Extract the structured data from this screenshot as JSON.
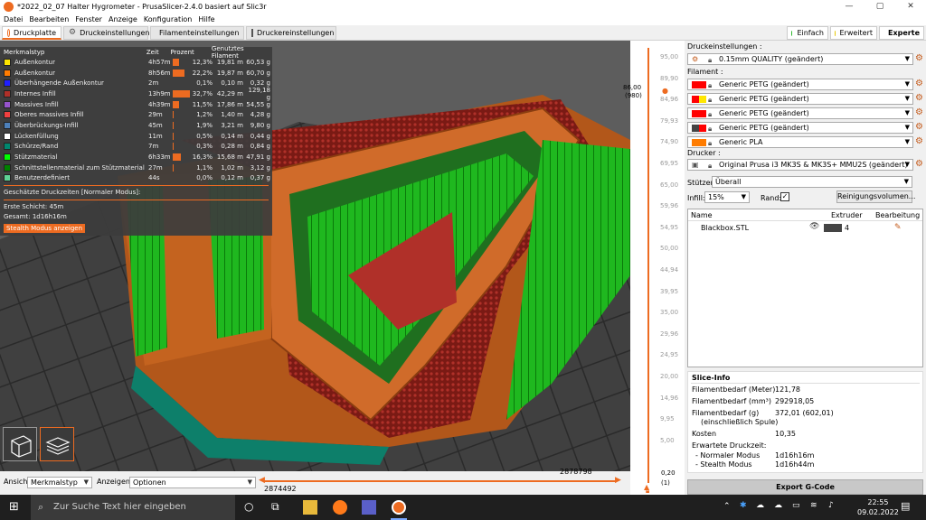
{
  "window": {
    "title": "*2022_02_07 Halter Hygrometer - PrusaSlicer-2.4.0 basiert auf Slic3r",
    "controls": [
      "—",
      "▢",
      "✕"
    ]
  },
  "menu": [
    "Datei",
    "Bearbeiten",
    "Fenster",
    "Anzeige",
    "Konfiguration",
    "Hilfe"
  ],
  "tabs": [
    "Druckplatte",
    "Druckeinstellungen",
    "Filamenteinstellungen",
    "Druckereinstellungen"
  ],
  "modes": {
    "einfach": "Einfach",
    "erweitert": "Erweitert",
    "experte": "Experte",
    "colors": {
      "einfach": "#2eb82e",
      "erweitert": "#e5c700",
      "experte": "#d00000"
    }
  },
  "legend": {
    "headers": {
      "type": "Merkmalstyp",
      "time": "Zeit",
      "percent": "Prozent",
      "filament": "Genutztes Filament"
    },
    "rows": [
      {
        "name": "Außenkontur",
        "time": "4h57m",
        "pct": "12,3%",
        "len": "19,81 m",
        "g": "60,53 g",
        "color": "#ffe600",
        "pct_value": 12.3
      },
      {
        "name": "Außenkontur",
        "time": "8h56m",
        "pct": "22,2%",
        "len": "19,87 m",
        "g": "60,70 g",
        "color": "#ff7c00",
        "pct_value": 22.2
      },
      {
        "name": "Überhängende Außenkontur",
        "time": "2m",
        "pct": "0,1%",
        "len": "0,10 m",
        "g": "0,32 g",
        "color": "#1f1fff",
        "pct_value": 0.1
      },
      {
        "name": "Internes Infill",
        "time": "13h9m",
        "pct": "32,7%",
        "len": "42,29 m",
        "g": "129,18 g",
        "color": "#b03029",
        "pct_value": 32.7
      },
      {
        "name": "Massives Infill",
        "time": "4h39m",
        "pct": "11,5%",
        "len": "17,86 m",
        "g": "54,55 g",
        "color": "#9654cc",
        "pct_value": 11.5
      },
      {
        "name": "Oberes massives Infill",
        "time": "29m",
        "pct": "1,2%",
        "len": "1,40 m",
        "g": "4,28 g",
        "color": "#f04040",
        "pct_value": 1.2
      },
      {
        "name": "Überbrückungs-Infill",
        "time": "45m",
        "pct": "1,9%",
        "len": "3,21 m",
        "g": "9,80 g",
        "color": "#4d80ba",
        "pct_value": 1.9
      },
      {
        "name": "Lückenfüllung",
        "time": "11m",
        "pct": "0,5%",
        "len": "0,14 m",
        "g": "0,44 g",
        "color": "#ffffff",
        "pct_value": 0.5
      },
      {
        "name": "Schürze/Rand",
        "time": "7m",
        "pct": "0,3%",
        "len": "0,28 m",
        "g": "0,84 g",
        "color": "#00876e",
        "pct_value": 0.3
      },
      {
        "name": "Stützmaterial",
        "time": "6h33m",
        "pct": "16,3%",
        "len": "15,68 m",
        "g": "47,91 g",
        "color": "#00ff00",
        "pct_value": 16.3
      },
      {
        "name": "Schnittstellenmaterial zum Stützmaterial",
        "time": "27m",
        "pct": "1,1%",
        "len": "1,02 m",
        "g": "3,12 g",
        "color": "#008000",
        "pct_value": 1.1
      },
      {
        "name": "Benutzerdefiniert",
        "time": "44s",
        "pct": "0,0%",
        "len": "0,12 m",
        "g": "0,37 g",
        "color": "#5ed194",
        "pct_value": 0.0
      }
    ],
    "est_title": "Geschätzte Druckzeiten [Normaler Modus]:",
    "first_layer": "Erste Schicht:  45m",
    "total": "Gesamt:        1d16h16m",
    "stealth_button": "Stealth Modus anzeigen"
  },
  "bottom": {
    "view_label": "Ansicht",
    "view_value": "Merkmalstyp",
    "show_label": "Anzeigen",
    "show_value": "Optionen",
    "h_left": "2874492",
    "h_right": "2878798"
  },
  "vslider": {
    "ticks": [
      "95,00",
      "89,90",
      "84,96",
      "79,93",
      "74,90",
      "69,95",
      "65,00",
      "59,96",
      "54,95",
      "50,00",
      "44,94",
      "39,95",
      "35,00",
      "29,96",
      "24,95",
      "20,00",
      "14,96",
      "9,95",
      "5,00"
    ],
    "top_value": "86,00",
    "top_layer": "(980)",
    "bottom_value": "0,20",
    "bottom_layer": "(1)"
  },
  "panel": {
    "print_label": "Druckeinstellungen :",
    "print_value": "0.15mm QUALITY (geändert)",
    "filament_label": "Filament :",
    "filaments": [
      {
        "name": "Generic PETG (geändert)",
        "color": "#ff0000",
        "color2": "#ff0000"
      },
      {
        "name": "Generic PETG (geändert)",
        "color": "#ff0000",
        "color2": "#ffe600"
      },
      {
        "name": "Generic PETG (geändert)",
        "color": "#ff0000",
        "color2": "#ff0000"
      },
      {
        "name": "Generic PETG (geändert)",
        "color": "#444444",
        "color2": "#ff0000"
      },
      {
        "name": "Generic PLA",
        "color": "#ff7c00",
        "color2": "#ff7c00"
      }
    ],
    "printer_label": "Drucker :",
    "printer_value": "Original Prusa i3 MK3S & MK3S+ MMU2S (geändert)",
    "support_label": "Stützen:",
    "support_value": "Überall",
    "infill_label": "Infill:",
    "infill_value": "15%",
    "brim_label": "Rand:",
    "purge_button": "Reinigungsvolumen...",
    "objlist": {
      "col_name": "Name",
      "col_extruder": "Extruder",
      "col_edit": "Bearbeitung",
      "object": "Blackbox.STL",
      "extruder": "4",
      "extruder_color": "#444444"
    },
    "slice_info": {
      "title": "Slice-Info",
      "rows": [
        {
          "k": "Filamentbedarf (Meter)",
          "v": "121,78"
        },
        {
          "k": "Filamentbedarf (mm³)",
          "v": "292918,05"
        },
        {
          "k": "Filamentbedarf (g)",
          "v": "372,01 (602,01)"
        },
        {
          "k": "(einschließlich Spule)",
          "v": ""
        },
        {
          "k": "Kosten",
          "v": "10,35"
        },
        {
          "k": "Erwartete Druckzeit:",
          "v": ""
        },
        {
          "k": "- Normaler Modus",
          "v": "1d16h16m"
        },
        {
          "k": "- Stealth Modus",
          "v": "1d16h44m"
        }
      ]
    },
    "export_button": "Export G-Code"
  },
  "taskbar": {
    "search": "Zur Suche Text hier eingeben",
    "time": "22:55",
    "date": "09.02.2022"
  }
}
